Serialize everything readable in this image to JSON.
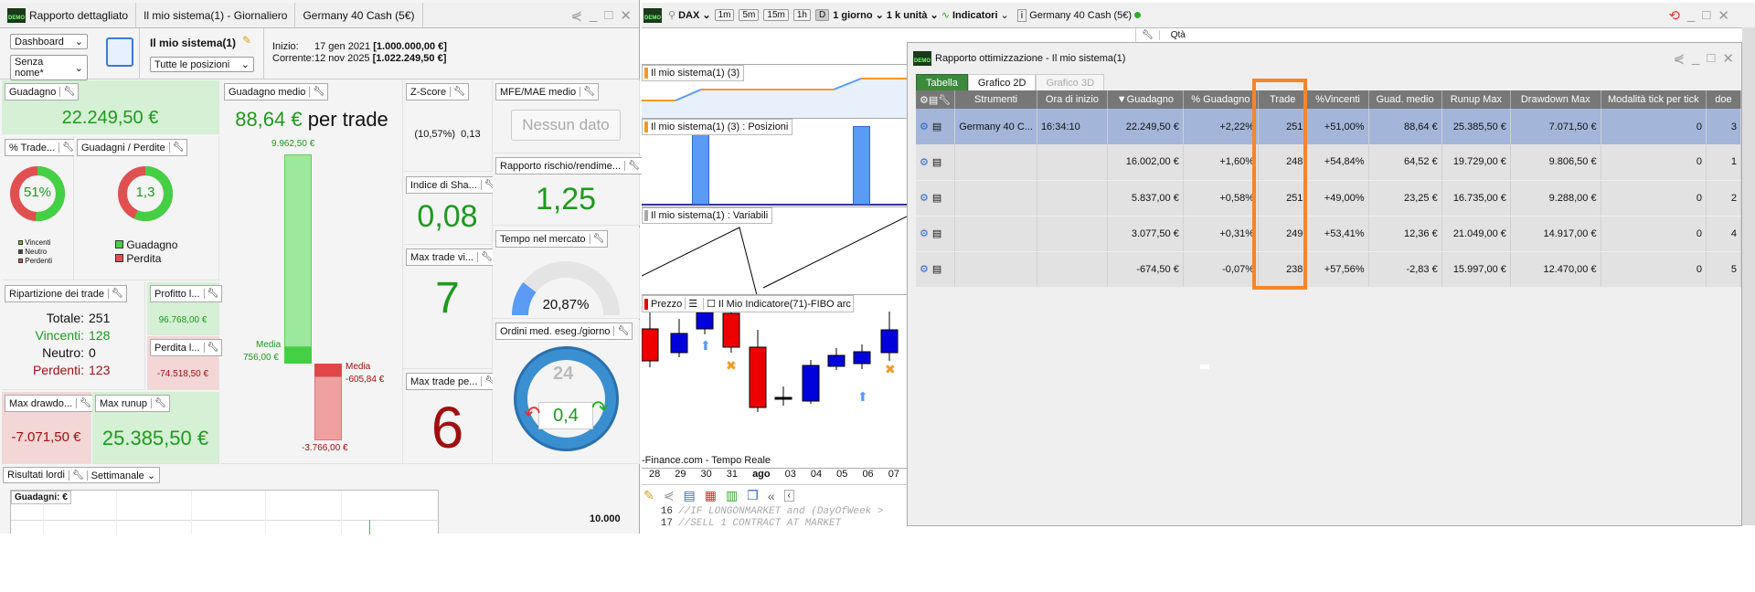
{
  "left": {
    "title_app": "Rapporto dettagliato",
    "title_system": "Il mio sistema(1) - Giornaliero",
    "title_instrument": "Germany 40 Cash (5€)",
    "dashboard_select": "Dashboard",
    "layout_select": "Senza nome*",
    "system_name": "Il mio sistema(1)",
    "positions_select": "Tutte le posizioni",
    "start_label": "Inizio:",
    "start_date": "17 gen 2021",
    "start_value": "[1.000.000,00 €]",
    "current_label": "Corrente:",
    "current_date": "12 nov 2025",
    "current_value": "[1.022.249,50 €]",
    "guadagno": {
      "label": "Guadagno",
      "value": "22.249,50 €"
    },
    "pct_trade": {
      "label": "% Trade...",
      "value": "51%",
      "fraction": 0.51,
      "legend": [
        "Vincenti",
        "Neutro",
        "Perdenti"
      ]
    },
    "gain_loss": {
      "label": "Guadagni / Perdite",
      "value": "1,3",
      "legend": [
        "Guadagno",
        "Perdita"
      ]
    },
    "avg_gain": {
      "label": "Guadagno medio",
      "value": "88,64 €",
      "suffix": "per trade",
      "max_win": "9.962,50 €",
      "avg_win_label": "Media",
      "avg_win": "756,00 €",
      "avg_loss_label": "Media",
      "avg_loss": "-605,84 €",
      "max_loss": "-3.766,00 €"
    },
    "zscore": {
      "label": "Z-Score",
      "value": "(10,57%)  0,13"
    },
    "mfe": {
      "label": "MFE/MAE medio",
      "value": "Nessun dato"
    },
    "risk": {
      "label": "Rapporto rischio/rendime...",
      "value": "1,25"
    },
    "sharpe": {
      "label": "Indice di Sha...",
      "value": "0,08"
    },
    "max_win_trades": {
      "label": "Max trade vi...",
      "value": "7"
    },
    "time_market": {
      "label": "Tempo nel mercato",
      "value": "20,87%",
      "fraction": 0.2087
    },
    "orders": {
      "label": "Ordini med. eseg./giorno",
      "hours": "24",
      "value": "0,4"
    },
    "max_loss_trades": {
      "label": "Max trade pe...",
      "value": "6"
    },
    "breakdown": {
      "label": "Ripartizione dei trade",
      "total_label": "Totale:",
      "total": "251",
      "win_label": "Vincenti:",
      "win": "128",
      "neutral_label": "Neutro:",
      "neutral": "0",
      "loss_label": "Perdenti:",
      "loss": "123"
    },
    "profit": {
      "label": "Profitto l...",
      "value": "96.768,00 €"
    },
    "loss": {
      "label": "Perdita l...",
      "value": "-74.518,50 €"
    },
    "drawdown": {
      "label": "Max drawdo...",
      "value": "-7.071,50 €"
    },
    "runup": {
      "label": "Max runup",
      "value": "25.385,50 €"
    },
    "results": {
      "label": "Risultati lordi",
      "period": "Settimanale",
      "chart_title": "Guadagni: €",
      "tick": "10.000"
    }
  },
  "middle": {
    "symbol": "DAX",
    "timeframes": [
      "1m",
      "5m",
      "15m",
      "1h",
      "D"
    ],
    "period": "1 giorno",
    "units": "1 k unità",
    "indicators": "Indicatori",
    "instrument": "Germany 40 Cash (5€)",
    "qty_header": "Qtà",
    "panel1": "Il mio sistema(1) (3)",
    "panel2": "Il mio sistema(1) (3) : Posizioni",
    "panel3": "Il mio sistema(1) : Variabili",
    "price_label": "Prezzo",
    "indicator_label": "Il Mio Indicatore(71)-FIBO arc",
    "source": "-Finance.com - Tempo Reale",
    "dates": [
      "28",
      "29",
      "30",
      "31",
      "ago",
      "03",
      "04",
      "05",
      "06",
      "07"
    ],
    "code": [
      {
        "n": "16",
        "t": "//IF LONGONMARKET and (DayOfWeek >"
      },
      {
        "n": "17",
        "t": "//SELL 1 CONTRACT AT MARKET"
      }
    ]
  },
  "opt": {
    "title": "Rapporto ottimizzazione - Il mio sistema(1)",
    "tabs": [
      "Tabella",
      "Grafico 2D",
      "Grafico 3D"
    ],
    "columns": [
      "Strumenti",
      "Ora di inizio",
      "▼Guadagno",
      "% Guadagno",
      "Trade",
      "%Vincenti",
      "Guad. medio",
      "Runup Max",
      "Drawdown Max",
      "Modalità tick per tick",
      "doe"
    ],
    "rows": [
      [
        "Germany 40 C...",
        "16:34:10",
        "22.249,50 €",
        "+2,22%",
        "251",
        "+51,00%",
        "88,64 €",
        "25.385,50 €",
        "7.071,50 €",
        "0",
        "3"
      ],
      [
        "",
        "",
        "16.002,00 €",
        "+1,60%",
        "248",
        "+54,84%",
        "64,52 €",
        "19.729,00 €",
        "9.806,50 €",
        "0",
        "1"
      ],
      [
        "",
        "",
        "5.837,00 €",
        "+0,58%",
        "251",
        "+49,00%",
        "23,25 €",
        "16.735,00 €",
        "9.288,00 €",
        "0",
        "2"
      ],
      [
        "",
        "",
        "3.077,50 €",
        "+0,31%",
        "249",
        "+53,41%",
        "12,36 €",
        "21.049,00 €",
        "14.917,00 €",
        "0",
        "4"
      ],
      [
        "",
        "",
        "-674,50 €",
        "-0,07%",
        "238",
        "+57,56%",
        "-2,83 €",
        "15.997,00 €",
        "12.470,00 €",
        "0",
        "5"
      ]
    ],
    "highlight_color": "#f5852a"
  }
}
